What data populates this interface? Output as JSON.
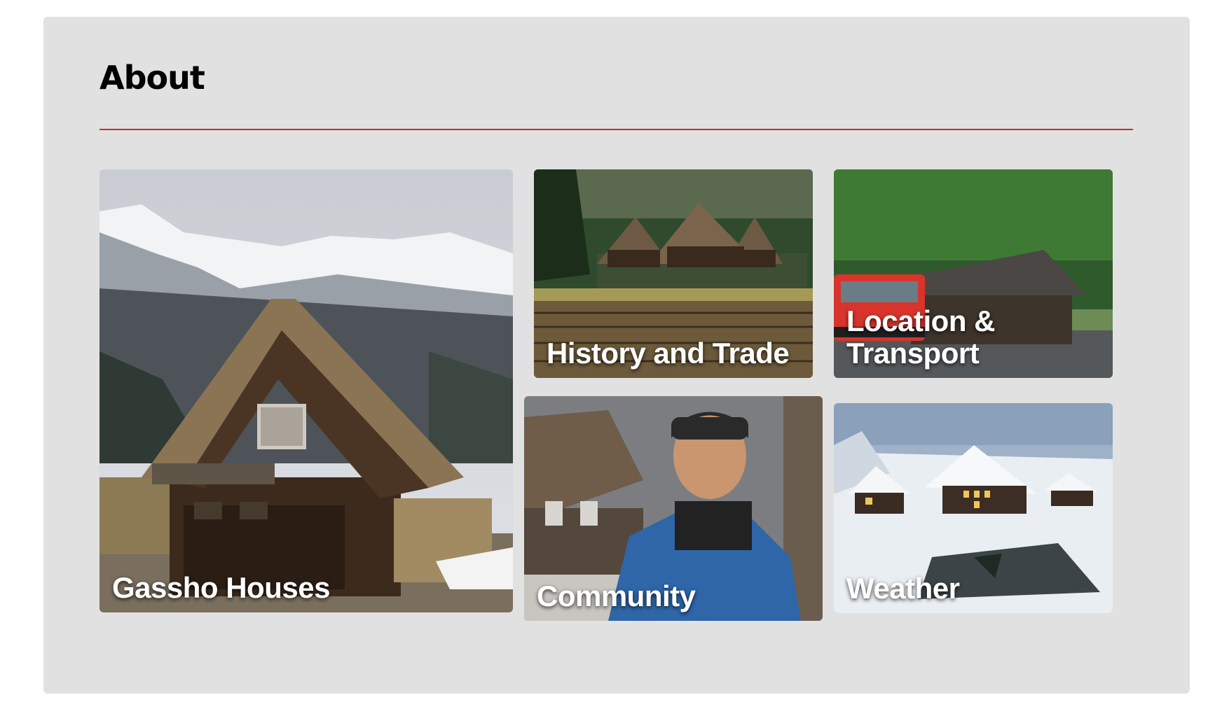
{
  "section": {
    "title": "About",
    "accent_color": "#d42a2a",
    "panel_color": "#e1e1e1"
  },
  "cards": [
    {
      "label": "Gassho Houses",
      "image": "thatched-gassho-house-with-snowy-mountains"
    },
    {
      "label": "History and Trade",
      "image": "gassho-houses-behind-rice-field"
    },
    {
      "label": "Location &\nTransport",
      "image": "bus-terminal-with-red-bus"
    },
    {
      "label": "Community",
      "image": "portrait-man-in-blue-jacket-beanie"
    },
    {
      "label": "Weather",
      "image": "snow-covered-village-at-dusk"
    }
  ]
}
